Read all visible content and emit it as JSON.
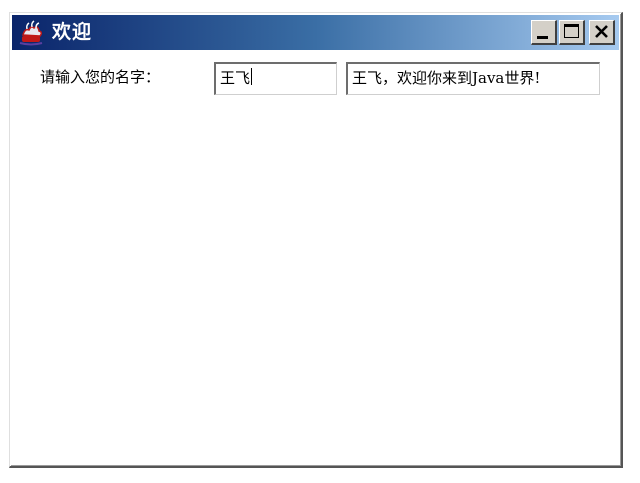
{
  "window": {
    "title": "欢迎"
  },
  "form": {
    "prompt_label": "请输入您的名字：",
    "name_value": "王飞",
    "greeting_value": "王飞，欢迎你来到Java世界!"
  },
  "icons": {
    "app": "java-app-icon",
    "minimize": "minimize-icon",
    "maximize": "maximize-icon",
    "close": "close-icon"
  },
  "colors": {
    "titlebar_start": "#0a246a",
    "titlebar_end": "#a6caf0",
    "button_face": "#d4d0c8"
  }
}
